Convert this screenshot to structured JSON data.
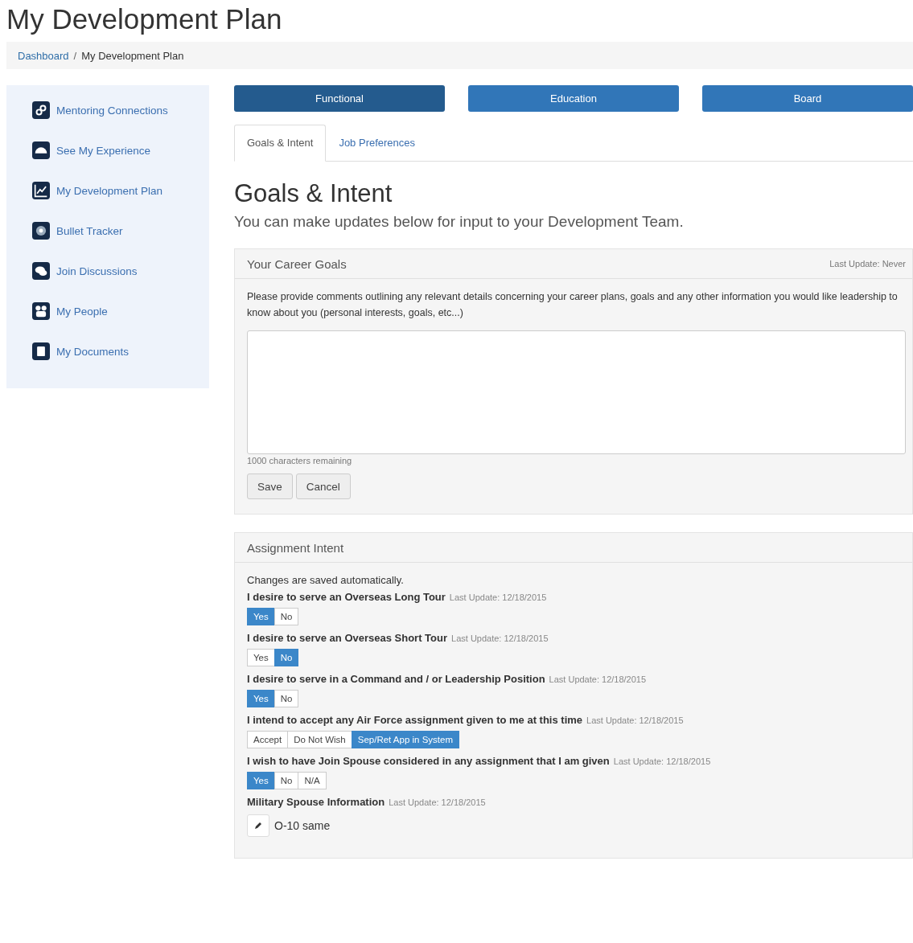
{
  "page_title": "My Development Plan",
  "breadcrumb": [
    {
      "kind": "link",
      "label": "Dashboard"
    },
    {
      "kind": "separator",
      "label": "/"
    },
    {
      "kind": "current",
      "label": "My Development Plan"
    }
  ],
  "sidebar": {
    "items": [
      {
        "label": "Mentoring Connections"
      },
      {
        "label": "See My Experience"
      },
      {
        "label": "My Development Plan"
      },
      {
        "label": "Bullet Tracker"
      },
      {
        "label": "Join Discussions"
      },
      {
        "label": "My People"
      },
      {
        "label": "My Documents"
      }
    ]
  },
  "categories": [
    {
      "label": "Functional",
      "selected": true
    },
    {
      "label": "Education",
      "selected": false
    },
    {
      "label": "Board",
      "selected": false
    }
  ],
  "tabs": [
    {
      "label": "Goals & Intent",
      "selected": true
    },
    {
      "label": "Job Preferences",
      "selected": false
    }
  ],
  "heading": "Goals & Intent",
  "subheading": "You can make updates below for input to your Development Team.",
  "career_goals": {
    "title": "Your Career Goals",
    "last_update": "Last Update: Never",
    "instructions": "Please provide comments outlining any relevant details concerning your career plans, goals and any other information you would like leadership to know about you (personal interests, goals, etc...)",
    "counter": "1000 characters remaining",
    "buttons": [
      "Save",
      "Cancel"
    ]
  },
  "assignment_intent": {
    "title": "Assignment Intent",
    "note": "Changes are saved automatically.",
    "questions": [
      {
        "kind": "choice",
        "label": "I desire to serve an Overseas Long Tour",
        "last_update": "Last Update: 12/18/2015",
        "options": [
          {
            "label": "Yes",
            "selected": true
          },
          {
            "label": "No",
            "selected": false
          }
        ]
      },
      {
        "kind": "choice",
        "label": "I desire to serve an Overseas Short Tour",
        "last_update": "Last Update: 12/18/2015",
        "options": [
          {
            "label": "Yes",
            "selected": false
          },
          {
            "label": "No",
            "selected": true
          }
        ]
      },
      {
        "kind": "choice",
        "label": "I desire to serve in a Command and / or Leadership Position",
        "last_update": "Last Update: 12/18/2015",
        "options": [
          {
            "label": "Yes",
            "selected": true
          },
          {
            "label": "No",
            "selected": false
          }
        ]
      },
      {
        "kind": "choice",
        "label": "I intend to accept any Air Force assignment given to me at this time",
        "last_update": "Last Update: 12/18/2015",
        "options": [
          {
            "label": "Accept",
            "selected": false
          },
          {
            "label": "Do Not Wish",
            "selected": false
          },
          {
            "label": "Sep/Ret App in System",
            "selected": true
          }
        ]
      },
      {
        "kind": "choice",
        "label": "I wish to have Join Spouse considered in any assignment that I am given",
        "last_update": "Last Update: 12/18/2015",
        "options": [
          {
            "label": "Yes",
            "selected": true
          },
          {
            "label": "No",
            "selected": false
          },
          {
            "label": "N/A",
            "selected": false
          }
        ]
      },
      {
        "kind": "edit",
        "label": "Military Spouse Information",
        "last_update": "Last Update: 12/18/2015",
        "value": "O-10 same"
      }
    ]
  }
}
